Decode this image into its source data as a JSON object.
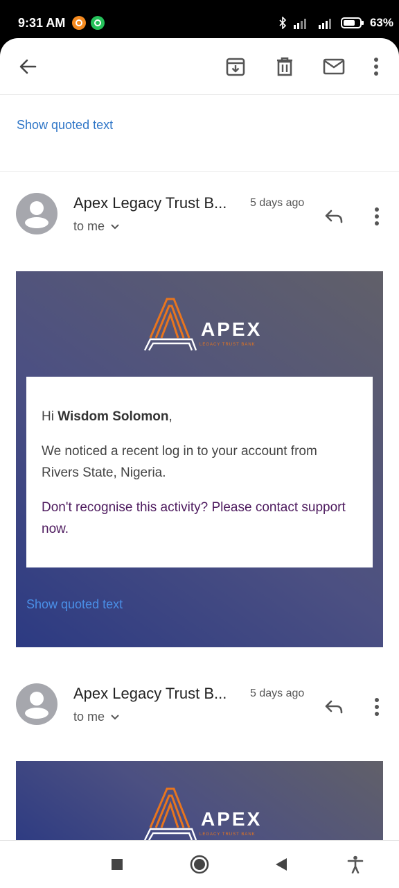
{
  "status_bar": {
    "time": "9:31 AM",
    "battery": "63%",
    "icons": [
      "bluetooth-icon",
      "signal-icon",
      "signal-4g-icon",
      "battery-icon"
    ]
  },
  "toolbar": {
    "icons": [
      "back-arrow-icon",
      "archive-icon",
      "trash-icon",
      "mail-icon",
      "more-vert-icon"
    ]
  },
  "thread": {
    "quoted_text_label": "Show quoted text",
    "messages": [
      {
        "sender": "Apex Legacy Trust B...",
        "time_ago": "5 days ago",
        "recipient": "to me",
        "logo_word": "APEX",
        "logo_tagline": "LEGACY TRUST BANK",
        "greeting_prefix": "Hi ",
        "greeting_name": "Wisdom Solomon",
        "greeting_suffix": ",",
        "body_text": "We noticed a recent log in to your account from Rivers State, Nigeria.",
        "warning_text": "Don't recognise this activity? Please contact support now.",
        "quoted_text_label": "Show quoted text"
      },
      {
        "sender": "Apex Legacy Trust B...",
        "time_ago": "5 days ago",
        "recipient": "to me",
        "logo_word": "APEX",
        "logo_tagline": "LEGACY TRUST BANK"
      }
    ]
  },
  "nav_bar": {
    "icons": [
      "recents-square-icon",
      "home-circle-icon",
      "back-triangle-icon",
      "accessibility-icon"
    ]
  },
  "colors": {
    "link": "#2f76c7",
    "logo_accent": "#e8751e",
    "banner_start": "#2c3a82",
    "banner_end": "#616069",
    "warning_text": "#4d1a5e"
  }
}
